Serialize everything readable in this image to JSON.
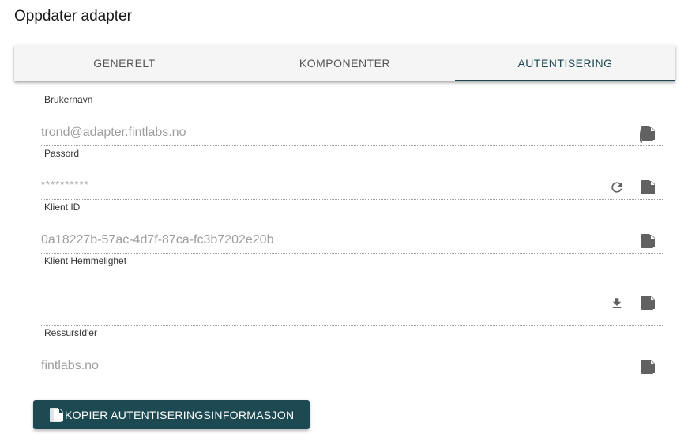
{
  "page": {
    "title": "Oppdater adapter"
  },
  "tabs": [
    {
      "label": "GENERELT",
      "active": false
    },
    {
      "label": "KOMPONENTER",
      "active": false
    },
    {
      "label": "AUTENTISERING",
      "active": true
    }
  ],
  "fields": {
    "username": {
      "label": "Brukernavn",
      "value": "trond@adapter.fintlabs.no",
      "icons": [
        "copy-icon"
      ]
    },
    "password": {
      "label": "Passord",
      "value": "**********",
      "icons": [
        "refresh-icon",
        "copy-icon"
      ]
    },
    "client_id": {
      "label": "Klient ID",
      "value": "0a18227b-57ac-4d7f-87ca-fc3b7202e20b",
      "icons": [
        "copy-icon"
      ]
    },
    "client_secret": {
      "label": "Klient Hemmelighet",
      "value": "",
      "icons": [
        "download-icon",
        "copy-icon"
      ]
    },
    "resource_ids": {
      "label": "RessursId'er",
      "value": "fintlabs.no",
      "icons": [
        "copy-icon"
      ]
    }
  },
  "actions": {
    "copy_all_label": "KOPIER AUTENTISERINGSINFORMASJON"
  },
  "colors": {
    "accent": "#1d4a52",
    "tab_bar": "#f5f5f5",
    "value_text": "#9e9e9e",
    "icon": "#616161"
  }
}
